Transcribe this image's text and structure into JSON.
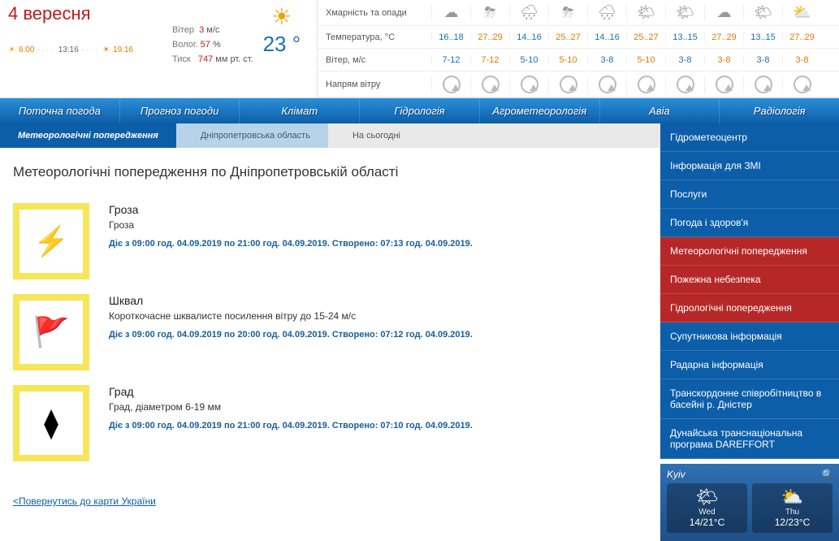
{
  "header": {
    "date": "4 вересня",
    "sunrise": "6:00",
    "solar_noon": "13:16",
    "sunset": "19:16",
    "current_temp": "23 °",
    "wind_label": "Вітер",
    "wind_value": "3",
    "wind_unit": "м/с",
    "humidity_label": "Волог.",
    "humidity_value": "57",
    "humidity_unit": "%",
    "pressure_label": "Тиск",
    "pressure_value": "747",
    "pressure_unit": "мм рт. ст."
  },
  "forecast": {
    "row_labels": {
      "clouds": "Хмарність та опади",
      "temp": "Температура, °С",
      "wind": "Вітер, м/с",
      "winddir": "Напрям вітру"
    },
    "clouds": [
      "☁",
      "⛈",
      "🌧",
      "⛈",
      "🌧",
      "🌤",
      "🌤",
      "☁",
      "🌤",
      "⛅"
    ],
    "temps": [
      "16..18",
      "27..29",
      "14..16",
      "25..27",
      "14..16",
      "25..27",
      "13..15",
      "27..29",
      "13..15",
      "27..29"
    ],
    "winds": [
      "7-12",
      "7-12",
      "5-10",
      "5-10",
      "3-8",
      "5-10",
      "3-8",
      "3-8",
      "3-8",
      "3-8"
    ],
    "alt": [
      "blue",
      "orange",
      "blue",
      "orange",
      "blue",
      "orange",
      "blue",
      "orange",
      "blue",
      "orange"
    ]
  },
  "nav": [
    "Поточна погода",
    "Прогноз погоди",
    "Клімат",
    "Гідрологія",
    "Агрометеорологія",
    "Авіа",
    "Радіологія"
  ],
  "crumbs": {
    "a": "Метеорологічні попередження",
    "b": "Дніпропетровська область",
    "c": "На сьогодні"
  },
  "page_title": "Метеорологічні попередження по Дніпропетровській області",
  "warnings": [
    {
      "icon": "⚡",
      "title": "Гроза",
      "desc": "Гроза",
      "valid": "Діє з 09:00 год. 04.09.2019 по 21:00 год. 04.09.2019. Створено: 07:13 год. 04.09.2019."
    },
    {
      "icon": "🚩",
      "title": "Шквал",
      "desc": "Короткочасне шквалисте посилення вітру до 15-24 м/с",
      "valid": "Діє з 09:00 год. 04.09.2019 по 20:00 год. 04.09.2019. Створено: 07:12 год. 04.09.2019."
    },
    {
      "icon": "⧫",
      "title": "Град",
      "desc": "Град, діаметром 6-19 мм",
      "valid": "Діє з 09:00 год. 04.09.2019 по 21:00 год. 04.09.2019. Створено: 07:10 год. 04.09.2019."
    }
  ],
  "back_link": "<Повернутись до карти України",
  "sidebar": [
    {
      "label": "Гідрометеоцентр",
      "cls": "blue"
    },
    {
      "label": "Інформація для ЗМІ",
      "cls": "blue"
    },
    {
      "label": "Послуги",
      "cls": "blue"
    },
    {
      "label": "Погода і здоров'я",
      "cls": "blue"
    },
    {
      "label": "Метеорологічні попередження",
      "cls": "red"
    },
    {
      "label": "Пожежна небезпека",
      "cls": "red"
    },
    {
      "label": "Гідрологічні попередження",
      "cls": "red"
    },
    {
      "label": "Супутникова інформація",
      "cls": "blue"
    },
    {
      "label": "Радарна інформація",
      "cls": "blue"
    },
    {
      "label": "Транскордонне співробітництво в басейні р. Дністер",
      "cls": "blue"
    },
    {
      "label": "Дунайська транснаціональна програма DAREFFORT",
      "cls": "blue"
    }
  ],
  "kyiv": {
    "city": "Kyiv",
    "days": [
      {
        "icon": "🌤",
        "name": "Wed",
        "temp": "14/21°C"
      },
      {
        "icon": "⛅",
        "name": "Thu",
        "temp": "12/23°C"
      }
    ]
  }
}
